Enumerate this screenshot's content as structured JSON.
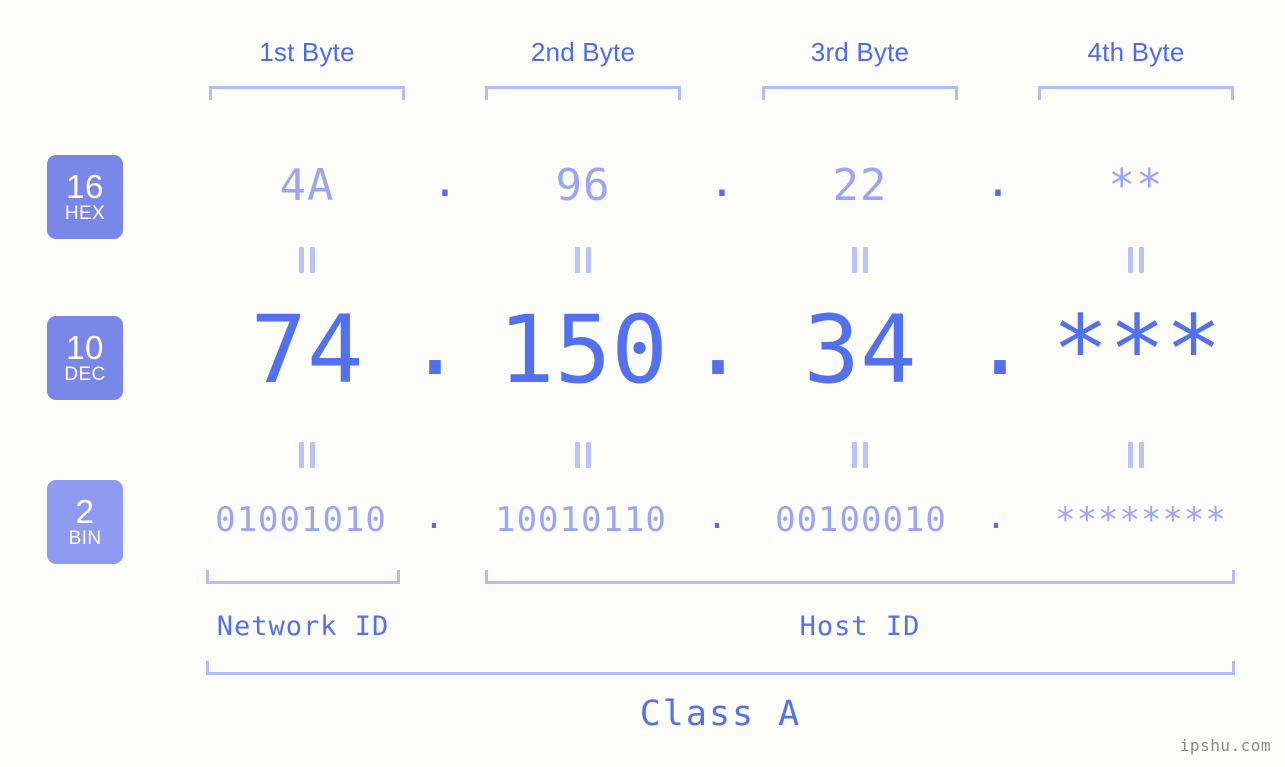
{
  "meta": {
    "background_color": "#fcfdf9",
    "accent_color": "#5370ef",
    "muted_accent_color": "#9aa6f5",
    "bracket_color": "#b3bcfb",
    "badge_color": "#7b87e8",
    "badge_color_light": "#8e9bf0",
    "watermark": "ipshu.com"
  },
  "byte_headers": [
    {
      "label": "1st Byte"
    },
    {
      "label": "2nd Byte"
    },
    {
      "label": "3rd Byte"
    },
    {
      "label": "4th Byte"
    }
  ],
  "rows": [
    {
      "id": "hex",
      "badge_number": "16",
      "badge_name": "HEX",
      "values": [
        "4A",
        "96",
        "22",
        "**"
      ],
      "separator": "."
    },
    {
      "id": "dec",
      "badge_number": "10",
      "badge_name": "DEC",
      "values": [
        "74",
        "150",
        "34",
        "***"
      ],
      "separator": "."
    },
    {
      "id": "bin",
      "badge_number": "2",
      "badge_name": "BIN",
      "values": [
        "01001010",
        "10010110",
        "00100010",
        "********"
      ],
      "separator": "."
    }
  ],
  "connectors": {
    "symbol": "||"
  },
  "id_sections": [
    {
      "label": "Network ID"
    },
    {
      "label": "Host ID"
    }
  ],
  "class_section": {
    "label": "Class A"
  }
}
